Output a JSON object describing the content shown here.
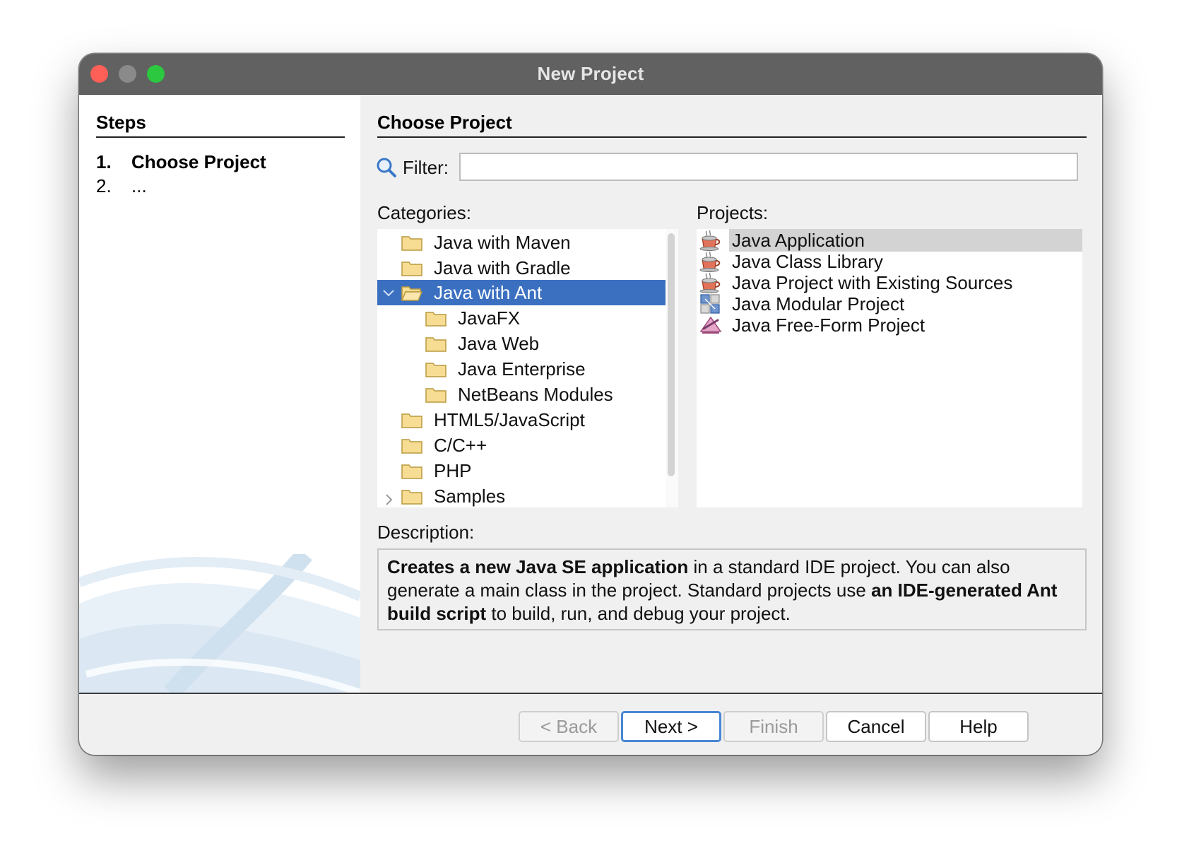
{
  "window": {
    "title": "New Project"
  },
  "steps": {
    "heading": "Steps",
    "items": [
      {
        "num": "1.",
        "label": "Choose Project"
      },
      {
        "num": "2.",
        "label": "..."
      }
    ]
  },
  "main": {
    "heading": "Choose Project",
    "filter": {
      "label": "Filter:",
      "value": ""
    },
    "categories_label": "Categories:",
    "projects_label": "Projects:",
    "categories": [
      {
        "label": "Java with Maven"
      },
      {
        "label": "Java with Gradle"
      },
      {
        "label": "Java with Ant",
        "selected": true,
        "expanded": true
      },
      {
        "label": "JavaFX"
      },
      {
        "label": "Java Web"
      },
      {
        "label": "Java Enterprise"
      },
      {
        "label": "NetBeans Modules"
      },
      {
        "label": "HTML5/JavaScript"
      },
      {
        "label": "C/C++"
      },
      {
        "label": "PHP"
      },
      {
        "label": "Samples"
      }
    ],
    "projects": [
      {
        "label": "Java Application",
        "icon": "coffee-cup-icon",
        "selected": true
      },
      {
        "label": "Java Class Library",
        "icon": "coffee-cup-icon"
      },
      {
        "label": "Java Project with Existing Sources",
        "icon": "coffee-cup-icon"
      },
      {
        "label": "Java Modular Project",
        "icon": "modules-icon"
      },
      {
        "label": "Java Free-Form Project",
        "icon": "freeform-icon"
      }
    ],
    "description_label": "Description:",
    "description": {
      "p1_bold": "Creates a new Java SE application",
      "p2": " in a standard IDE project. You can also generate a main class in the project. Standard projects use ",
      "p3_bold": "an IDE-generated Ant build script",
      "p4": " to build, run, and debug your project."
    }
  },
  "buttons": {
    "back": "< Back",
    "next": "Next >",
    "finish": "Finish",
    "cancel": "Cancel",
    "help": "Help"
  },
  "colors": {
    "selection": "#3b70c1",
    "titlebar": "#616161",
    "folder": "#f5d98b",
    "default_button_border": "#4a86d4"
  }
}
